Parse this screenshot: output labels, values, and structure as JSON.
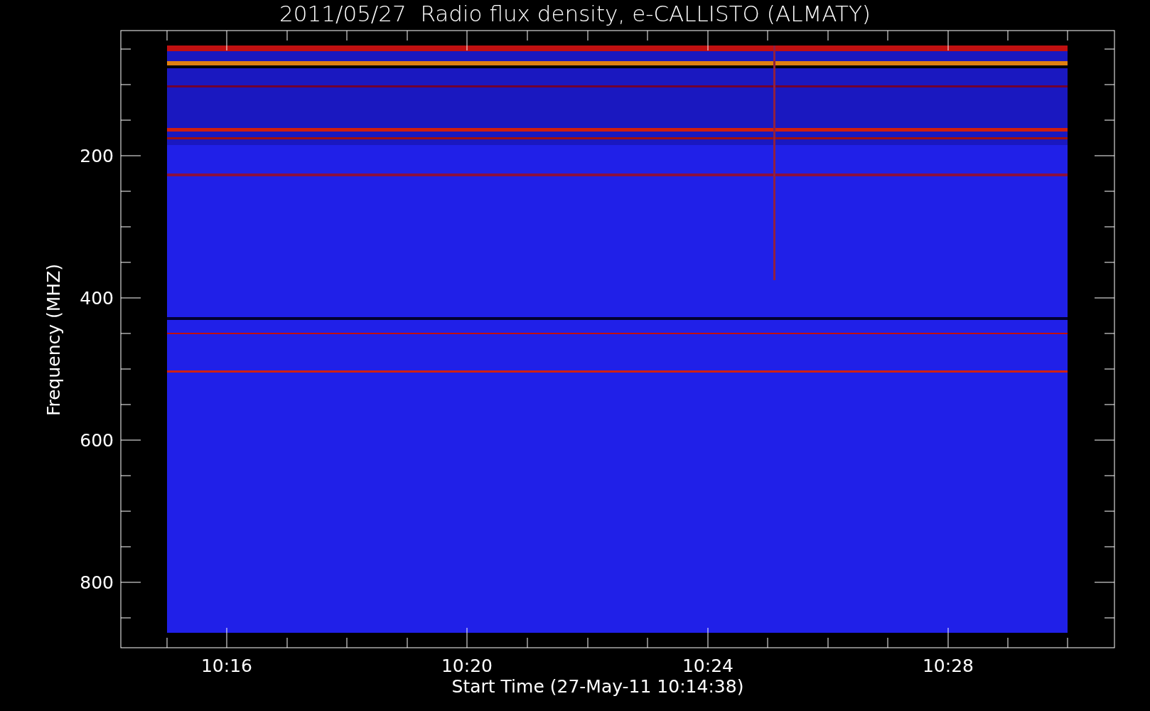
{
  "title": "2011/05/27  Radio flux density, e-CALLISTO (ALMATY)",
  "plot": {
    "ylabel": "Frequency (MHZ)",
    "xlabel": "Start Time (27-May-11 10:14:38)",
    "yticks": [
      "200",
      "400",
      "600",
      "800"
    ],
    "xticks": [
      "10:16",
      "10:20",
      "10:24",
      "10:28"
    ],
    "kind": "picture"
  }
}
